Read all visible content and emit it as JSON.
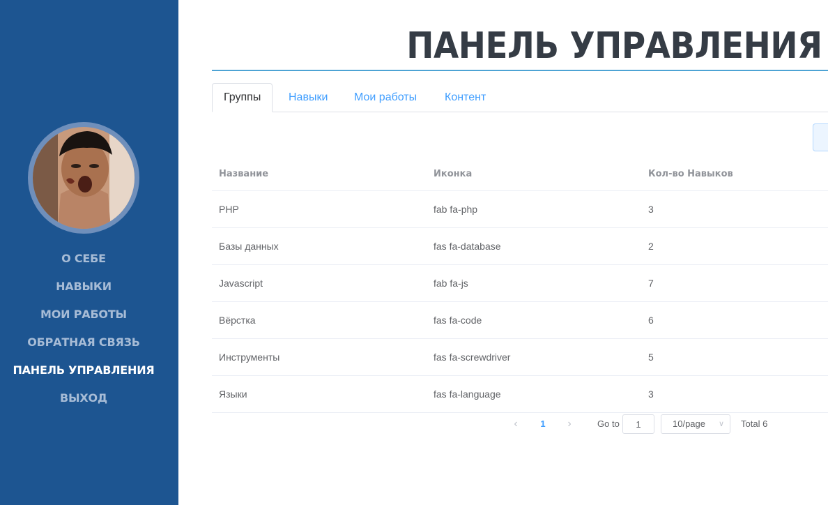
{
  "page_title": "ПАНЕЛЬ УПРАВЛЕНИЯ",
  "sidebar": {
    "avatar_icon": "user-photo",
    "items": [
      {
        "label": "О СЕБЕ",
        "active": false
      },
      {
        "label": "НАВЫКИ",
        "active": false
      },
      {
        "label": "МОИ РАБОТЫ",
        "active": false
      },
      {
        "label": "ОБРАТНАЯ СВЯЗЬ",
        "active": false
      },
      {
        "label": "ПАНЕЛЬ УПРАВЛЕНИЯ",
        "active": true
      },
      {
        "label": "ВЫХОД",
        "active": false
      }
    ]
  },
  "tabs": [
    {
      "label": "Группы",
      "active": true
    },
    {
      "label": "Навыки",
      "active": false
    },
    {
      "label": "Мои работы",
      "active": false
    },
    {
      "label": "Контент",
      "active": false
    }
  ],
  "table": {
    "headers": [
      "Название",
      "Иконка",
      "Кол-во Навыков"
    ],
    "rows": [
      [
        "PHP",
        "fab fa-php",
        "3"
      ],
      [
        "Базы данных",
        "fas fa-database",
        "2"
      ],
      [
        "Javascript",
        "fab fa-js",
        "7"
      ],
      [
        "Вёрстка",
        "fas fa-code",
        "6"
      ],
      [
        "Инструменты",
        "fas fa-screwdriver",
        "5"
      ],
      [
        "Языки",
        "fas fa-language",
        "3"
      ]
    ]
  },
  "pagination": {
    "prev_icon": "chevron-left-icon",
    "next_icon": "chevron-right-icon",
    "current_page": "1",
    "goto_label": "Go to",
    "goto_value": "1",
    "page_size": "10/page",
    "total": "Total 6"
  },
  "colors": {
    "sidebar_bg": "#1d5591",
    "accent": "#409eff",
    "title_rule": "#4da3d4"
  }
}
